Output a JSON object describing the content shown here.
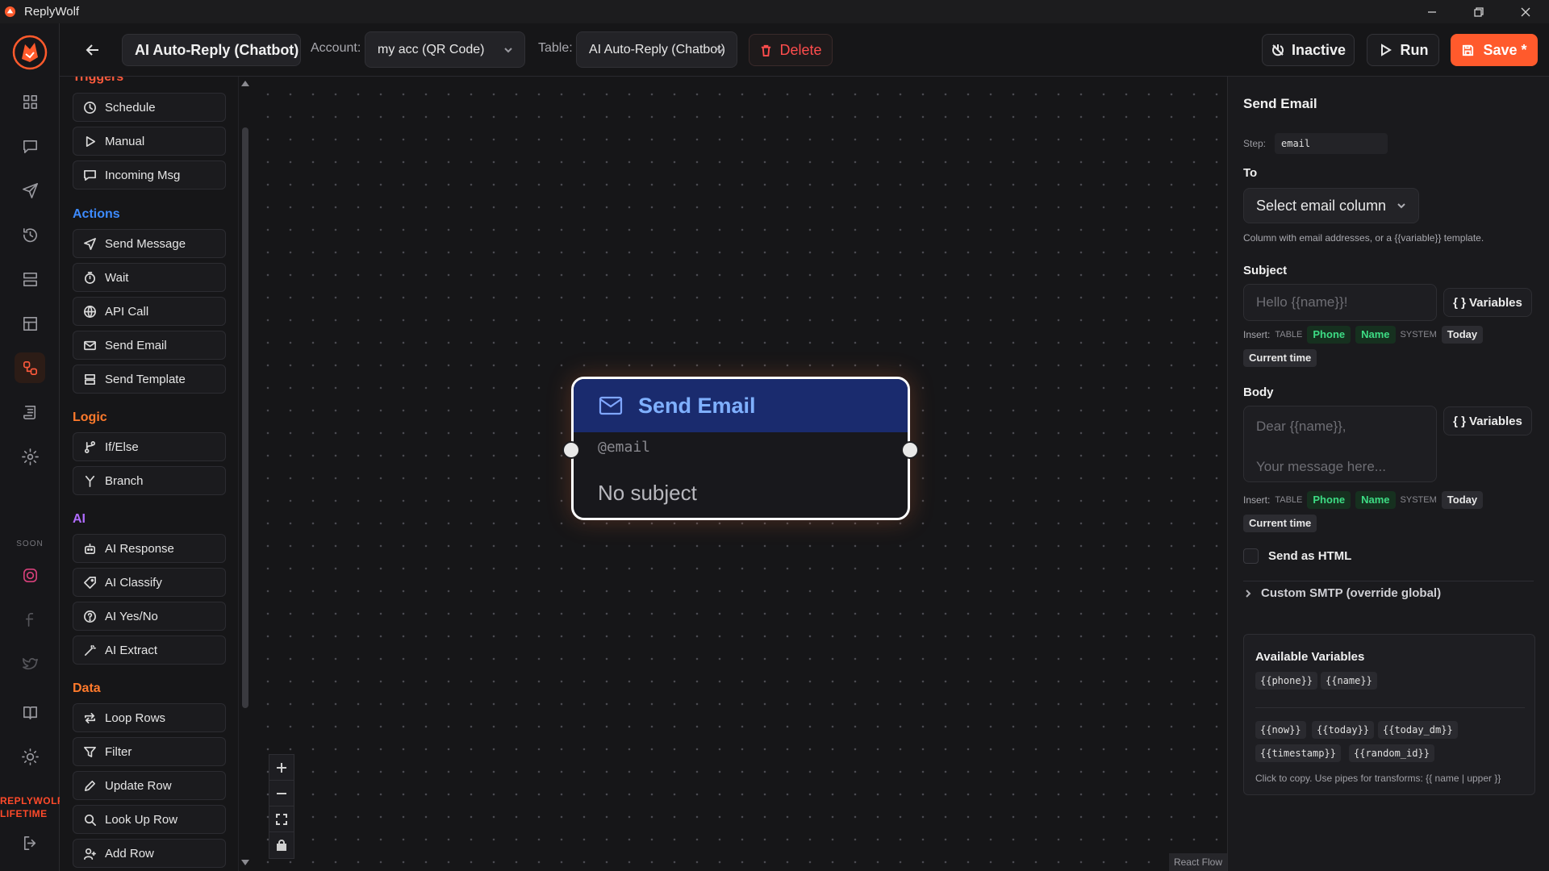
{
  "window": {
    "title": "ReplyWolf"
  },
  "rail": {
    "soon_label": "SOON",
    "lifetime_line1": "REPLYWOLF",
    "lifetime_line2": "LIFETIME"
  },
  "topbar": {
    "workflow_name": "AI Auto-Reply (Chatbot)",
    "account_label": "Account:",
    "account_value": "my acc (QR Code)",
    "table_label": "Table:",
    "table_value": "AI Auto-Reply (Chatbot)",
    "delete_label": "Delete",
    "inactive_label": "Inactive",
    "run_label": "Run",
    "save_label": "Save *"
  },
  "palette": {
    "triggers_label": "Triggers",
    "actions_label": "Actions",
    "logic_label": "Logic",
    "ai_label": "AI",
    "data_label": "Data",
    "triggers": [
      "Schedule",
      "Manual",
      "Incoming Msg"
    ],
    "actions": [
      "Send Message",
      "Wait",
      "API Call",
      "Send Email",
      "Send Template"
    ],
    "logic": [
      "If/Else",
      "Branch"
    ],
    "ai": [
      "AI Response",
      "AI Classify",
      "AI Yes/No",
      "AI Extract"
    ],
    "data": [
      "Loop Rows",
      "Filter",
      "Update Row",
      "Look Up Row",
      "Add Row"
    ]
  },
  "canvas": {
    "node": {
      "title": "Send Email",
      "to": "@email",
      "subject": "No subject"
    },
    "attribution": "React Flow"
  },
  "props": {
    "title": "Send Email",
    "step_label": "Step:",
    "step_value": "email",
    "to_label": "To",
    "to_select": "Select email column",
    "to_help": "Column with email addresses, or a {{variable}} template.",
    "subject_label": "Subject",
    "subject_placeholder": "Hello {{name}}!",
    "variables_btn": "Variables",
    "insert_label": "Insert:",
    "table_cat": "TABLE",
    "system_cat": "SYSTEM",
    "chip_phone": "Phone",
    "chip_name": "Name",
    "chip_today": "Today",
    "chip_current_time": "Current time",
    "body_label": "Body",
    "body_line1": "Dear {{name}},",
    "body_line2": "Your message here...",
    "send_html_label": "Send as HTML",
    "smtp_label": "Custom SMTP (override global)",
    "avail_title": "Available Variables",
    "vars_table": [
      "{{phone}}",
      "{{name}}"
    ],
    "vars_system": [
      "{{now}}",
      "{{today}}",
      "{{today_dm}}",
      "{{timestamp}}",
      "{{random_id}}"
    ],
    "avail_help": "Click to copy. Use pipes for transforms: {{ name | upper }}"
  },
  "colors": {
    "accent": "#ff5a2c",
    "node_header": "#1a2b6e",
    "chip_green": "#3ddc84",
    "delete_red": "#ff4d4d"
  }
}
